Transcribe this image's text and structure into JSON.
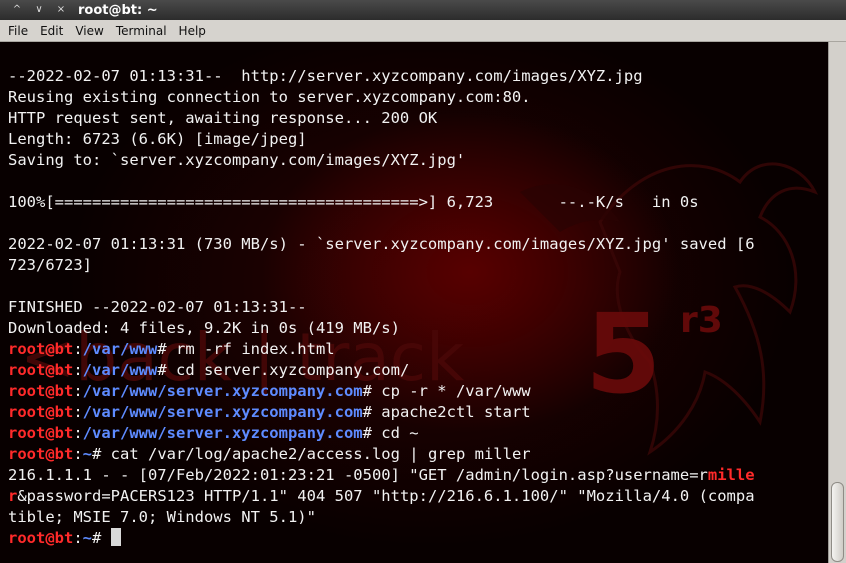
{
  "window": {
    "title": "root@bt: ~",
    "buttons": {
      "minimize": "^",
      "restore": "∨",
      "close": "×"
    }
  },
  "menu": [
    "File",
    "Edit",
    "View",
    "Terminal",
    "Help"
  ],
  "terminal": {
    "lines": [
      [
        {
          "t": "--2022-02-07 01:13:31--  http://server.xyzcompany.com/images/XYZ.jpg",
          "c": ""
        }
      ],
      [
        {
          "t": "Reusing existing connection to server.xyzcompany.com:80.",
          "c": ""
        }
      ],
      [
        {
          "t": "HTTP request sent, awaiting response... 200 OK",
          "c": ""
        }
      ],
      [
        {
          "t": "Length: 6723 (6.6K) [image/jpeg]",
          "c": ""
        }
      ],
      [
        {
          "t": "Saving to: `server.xyzcompany.com/images/XYZ.jpg'",
          "c": ""
        }
      ],
      [
        {
          "t": "",
          "c": ""
        }
      ],
      [
        {
          "t": "100%[=======================================>] 6,723       --.-K/s   in 0s",
          "c": ""
        }
      ],
      [
        {
          "t": "",
          "c": ""
        }
      ],
      [
        {
          "t": "2022-02-07 01:13:31 (730 MB/s) - `server.xyzcompany.com/images/XYZ.jpg' saved [6",
          "c": ""
        }
      ],
      [
        {
          "t": "723/6723]",
          "c": ""
        }
      ],
      [
        {
          "t": "",
          "c": ""
        }
      ],
      [
        {
          "t": "FINISHED --2022-02-07 01:13:31--",
          "c": ""
        }
      ],
      [
        {
          "t": "Downloaded: 4 files, 9.2K in 0s (419 MB/s)",
          "c": ""
        }
      ],
      [
        {
          "t": "root@bt",
          "c": "u"
        },
        {
          "t": ":",
          "c": ""
        },
        {
          "t": "/var/www",
          "c": "p"
        },
        {
          "t": "# rm -rf index.html",
          "c": ""
        }
      ],
      [
        {
          "t": "root@bt",
          "c": "u"
        },
        {
          "t": ":",
          "c": ""
        },
        {
          "t": "/var/www",
          "c": "p"
        },
        {
          "t": "# cd server.xyzcompany.com/",
          "c": ""
        }
      ],
      [
        {
          "t": "root@bt",
          "c": "u"
        },
        {
          "t": ":",
          "c": ""
        },
        {
          "t": "/var/www/server.xyzcompany.com",
          "c": "p"
        },
        {
          "t": "# cp -r * /var/www",
          "c": ""
        }
      ],
      [
        {
          "t": "root@bt",
          "c": "u"
        },
        {
          "t": ":",
          "c": ""
        },
        {
          "t": "/var/www/server.xyzcompany.com",
          "c": "p"
        },
        {
          "t": "# apache2ctl start",
          "c": ""
        }
      ],
      [
        {
          "t": "root@bt",
          "c": "u"
        },
        {
          "t": ":",
          "c": ""
        },
        {
          "t": "/var/www/server.xyzcompany.com",
          "c": "p"
        },
        {
          "t": "# cd ~",
          "c": ""
        }
      ],
      [
        {
          "t": "root@bt",
          "c": "u"
        },
        {
          "t": ":",
          "c": ""
        },
        {
          "t": "~",
          "c": "p"
        },
        {
          "t": "# cat /var/log/apache2/access.log | grep miller",
          "c": ""
        }
      ],
      [
        {
          "t": "216.1.1.1 - - [07/Feb/2022:01:23:21 -0500] \"GET /admin/login.asp?username=r",
          "c": ""
        },
        {
          "t": "mille",
          "c": "hl"
        }
      ],
      [
        {
          "t": "r",
          "c": "hl"
        },
        {
          "t": "&password=PACERS123 HTTP/1.1\" 404 507 \"http://216.6.1.100/\" \"Mozilla/4.0 (compa",
          "c": ""
        }
      ],
      [
        {
          "t": "tible; MSIE 7.0; Windows NT 5.1)\"",
          "c": ""
        }
      ],
      [
        {
          "t": "root@bt",
          "c": "u"
        },
        {
          "t": ":",
          "c": ""
        },
        {
          "t": "~",
          "c": "p"
        },
        {
          "t": "# ",
          "c": ""
        }
      ]
    ]
  },
  "logo": {
    "text": "<back | track",
    "number": "5",
    "superscript": "r3"
  },
  "colors": {
    "user": "#ff2a2a",
    "path": "#5e8bff",
    "text": "#f2f2f2",
    "logo": "#5a0a0a"
  }
}
